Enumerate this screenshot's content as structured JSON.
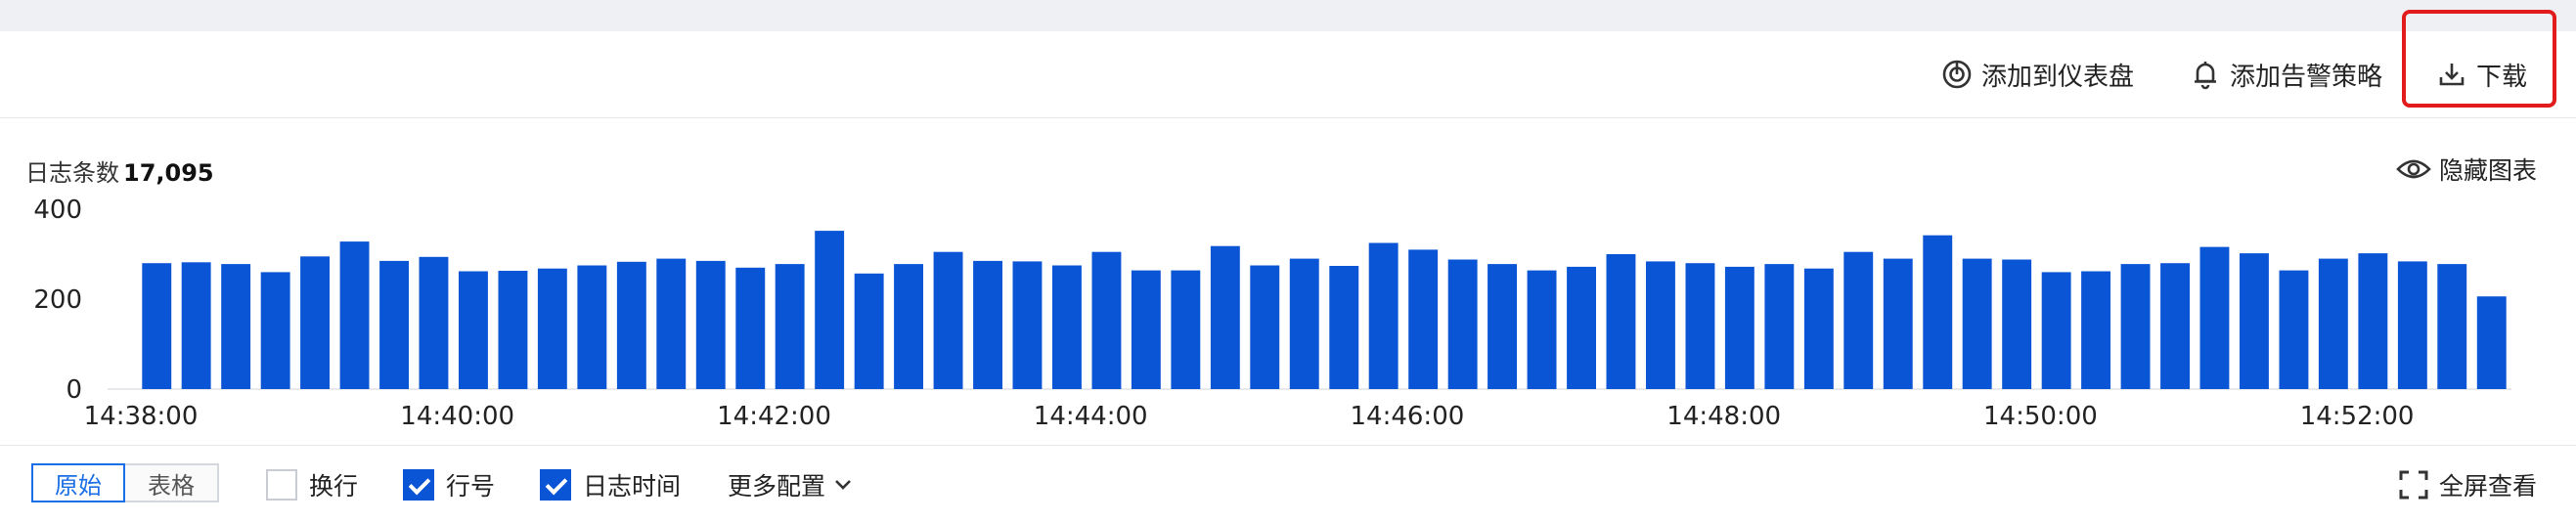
{
  "toolbar": {
    "add_dashboard": "添加到仪表盘",
    "add_alarm": "添加告警策略",
    "download": "下载"
  },
  "panel": {
    "log_count_label": "日志条数",
    "log_count_value": "17,095",
    "hide_chart": "隐藏图表"
  },
  "bottom": {
    "view_raw": "原始",
    "view_table": "表格",
    "wrap_label": "换行",
    "wrap_checked": false,
    "line_no_label": "行号",
    "line_no_checked": true,
    "log_time_label": "日志时间",
    "log_time_checked": true,
    "more_config": "更多配置",
    "fullscreen": "全屏查看"
  },
  "colors": {
    "bar": "#0a54d6",
    "accent": "#1a6ee6",
    "highlight": "#e21c1c"
  },
  "chart_data": {
    "type": "bar",
    "x_ticks": [
      "14:38:00",
      "14:40:00",
      "14:42:00",
      "14:44:00",
      "14:46:00",
      "14:48:00",
      "14:50:00",
      "14:52:00"
    ],
    "y_ticks": [
      "400",
      "200",
      "0"
    ],
    "ylim": [
      0,
      400
    ],
    "values": [
      280,
      282,
      278,
      260,
      295,
      328,
      285,
      294,
      262,
      263,
      268,
      275,
      283,
      290,
      285,
      270,
      278,
      352,
      257,
      278,
      305,
      285,
      284,
      275,
      305,
      264,
      264,
      318,
      275,
      290,
      274,
      325,
      310,
      288,
      278,
      264,
      272,
      300,
      284,
      280,
      272,
      278,
      268,
      305,
      290,
      342,
      290,
      288,
      260,
      262,
      278,
      280,
      316,
      302,
      264,
      290,
      302,
      284,
      278,
      206
    ]
  }
}
